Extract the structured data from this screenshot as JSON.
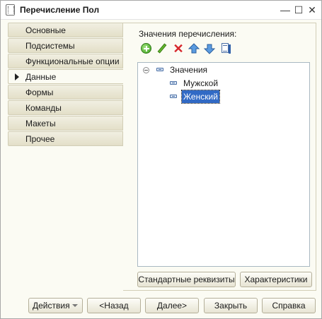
{
  "window": {
    "title": "Перечисление Пол",
    "controls": {
      "minimize": "—",
      "maximize": "☐",
      "close": "✕"
    }
  },
  "tabs": [
    {
      "label": "Основные",
      "active": false
    },
    {
      "label": "Подсистемы",
      "active": false
    },
    {
      "label": "Функциональные опции",
      "active": false
    },
    {
      "label": "Данные",
      "active": true
    },
    {
      "label": "Формы",
      "active": false
    },
    {
      "label": "Команды",
      "active": false
    },
    {
      "label": "Макеты",
      "active": false
    },
    {
      "label": "Прочее",
      "active": false
    }
  ],
  "panel": {
    "label": "Значения перечисления:",
    "toolbar": [
      "add-icon",
      "edit-icon",
      "delete-icon",
      "move-up-icon",
      "move-down-icon",
      "sort-list-icon"
    ],
    "tree": {
      "root": "Значения",
      "items": [
        "Мужской",
        "Женский"
      ],
      "selected": "Женский"
    },
    "buttons": {
      "standard_attributes": "Стандартные реквизиты",
      "characteristics": "Характеристики"
    }
  },
  "footer": {
    "actions": "Действия",
    "back": "<Назад",
    "next": "Далее>",
    "close": "Закрыть",
    "help": "Справка"
  },
  "colors": {
    "selection": "#316ac5",
    "tab_background": "#e3dfc8",
    "panel_background": "#fbfbf3"
  }
}
